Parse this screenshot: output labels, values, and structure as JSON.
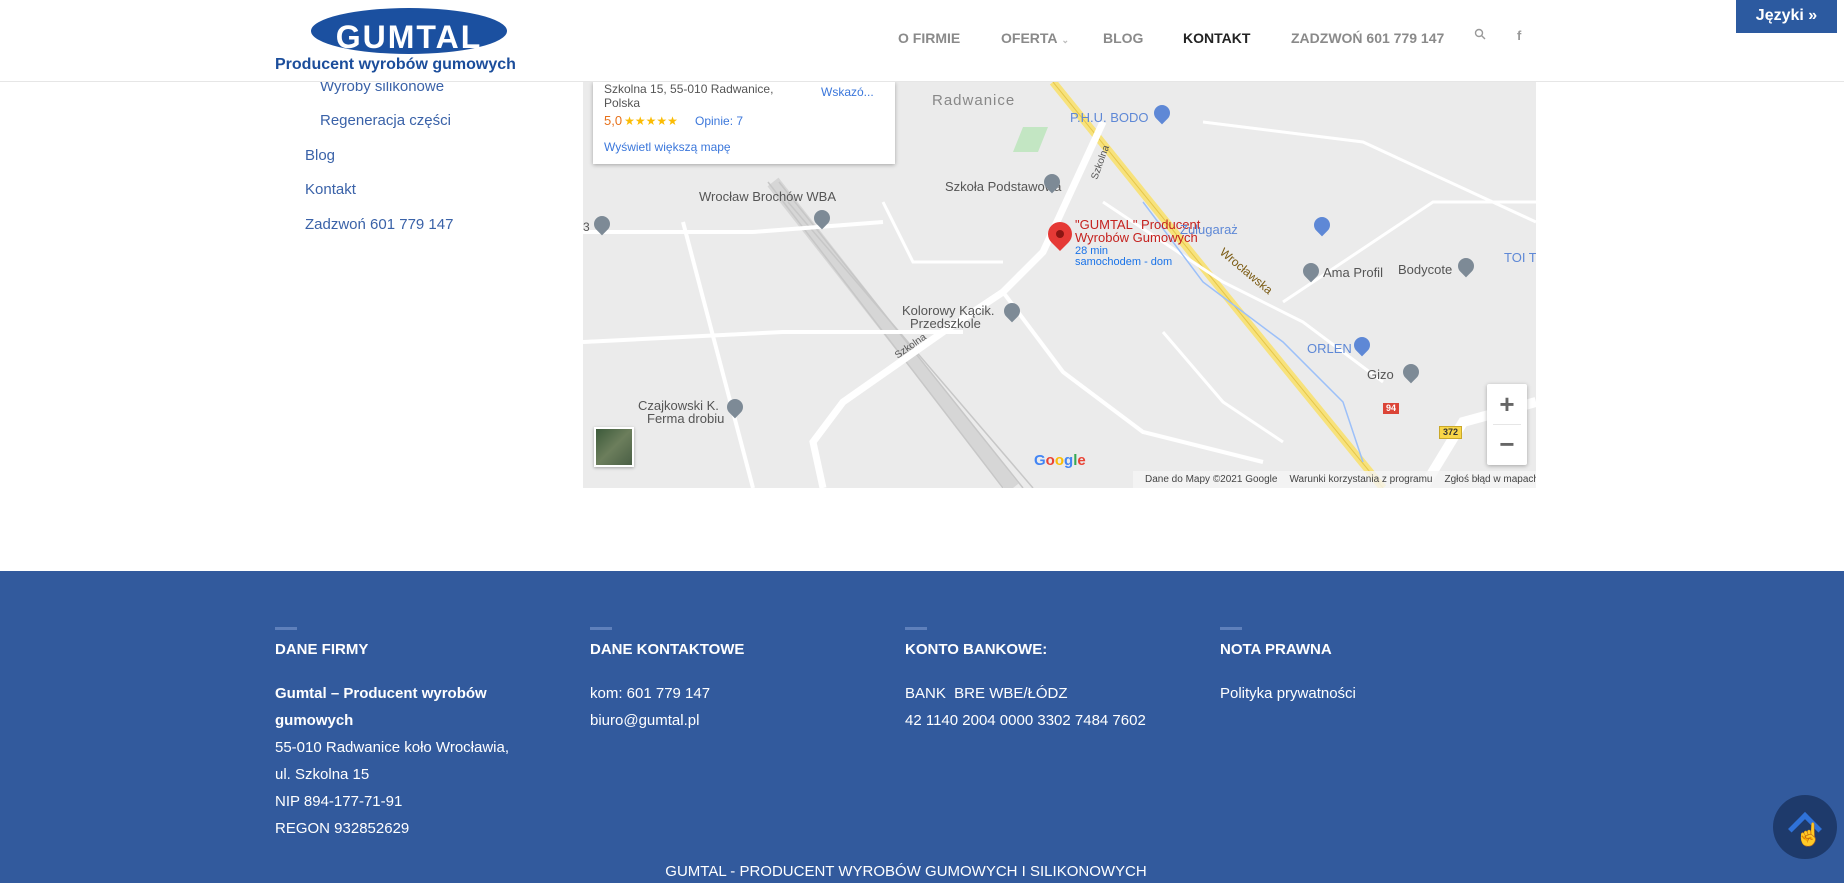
{
  "brand": {
    "logo_word": "GUMTAL",
    "tagline": "Producent wyrobów gumowych",
    "primary_color": "#325a9d",
    "logo_color": "#1b50a0"
  },
  "nav": {
    "items": [
      {
        "label": "O FIRMIE"
      },
      {
        "label": "OFERTA"
      },
      {
        "label": "BLOG"
      },
      {
        "label": "KONTAKT"
      },
      {
        "label": "ZADZWOŃ 601 779 147"
      }
    ],
    "icons": [
      "search-icon",
      "facebook-icon"
    ]
  },
  "language_button": "Języki »",
  "sidebar": {
    "items": [
      {
        "label": "Wyroby silikonowe"
      },
      {
        "label": "Regeneracja części"
      },
      {
        "label": "Blog"
      },
      {
        "label": "Kontakt"
      },
      {
        "label": "Zadzwoń 601 779 147"
      }
    ]
  },
  "map": {
    "info_card": {
      "address": "Szkolna 15, 55-010 Radwanice, Polska",
      "directions": "Wskazó...",
      "rating": "5,0",
      "stars": "★★★★★",
      "reviews": "Opinie: 7",
      "larger_map": "Wyświetl większą mapę"
    },
    "labels": {
      "radwanice": "Radwanice",
      "phu_bodo": "P.H.U. BODO",
      "szkola_podst": "Szkoła Podstawowa",
      "brochow": "Wrocław Brochów WBA",
      "gumtal_pin": "\"GUMTAL\" Producent",
      "gumtal_pin2": "Wyrobów Gumowych",
      "travel1": "28 min",
      "travel2": "samochodem - dom",
      "zulugaraz": "Zulugaraż",
      "wroclawska": "Wrocławska",
      "ama_profil": "Ama Profil",
      "bodycote": "Bodycote",
      "toi": "TOI T",
      "kolorowy1": "Kolorowy Kącik.",
      "kolorowy2": "Przedszkole",
      "orlen": "ORLEN",
      "gizo": "Gizo",
      "czajkowski1": "Czajkowski K.",
      "czajkowski2": "Ferma drobiu",
      "szkolna": "Szkolna",
      "szkolna2": "Szkolna",
      "num3": "3",
      "road94": "94",
      "road372": "372"
    },
    "zoom_in": "+",
    "zoom_out": "−",
    "google": "Google",
    "attribution": {
      "data": "Dane do Mapy ©2021 Google",
      "terms": "Warunki korzystania z programu",
      "report": "Zgłoś błąd w mapach"
    }
  },
  "footer": {
    "company": {
      "heading": "DANE FIRMY",
      "name": "Gumtal – Producent wyrobów gumowych",
      "name_line1": "Gumtal – Producent wyrobów",
      "name_line2": "gumowych",
      "address1": "55-010 Radwanice koło Wrocławia,",
      "address2": "ul. Szkolna 15",
      "nip": "NIP 894-177-71-91",
      "regon": "REGON 932852629"
    },
    "contact": {
      "heading": "DANE KONTAKTOWE",
      "phone": "kom: 601 779 147",
      "email": "biuro@gumtal.pl"
    },
    "bank": {
      "heading": "KONTO BANKOWE:",
      "bank_name": "BANK  BRE WBE/ŁÓDZ",
      "account": "42 1140 2004 0000 3302 7484 7602"
    },
    "legal": {
      "heading": "NOTA PRAWNA",
      "privacy": "Polityka prywatności"
    },
    "bottom": "GUMTAL - PRODUCENT WYROBÓW GUMOWYCH I SILIKONOWYCH"
  }
}
